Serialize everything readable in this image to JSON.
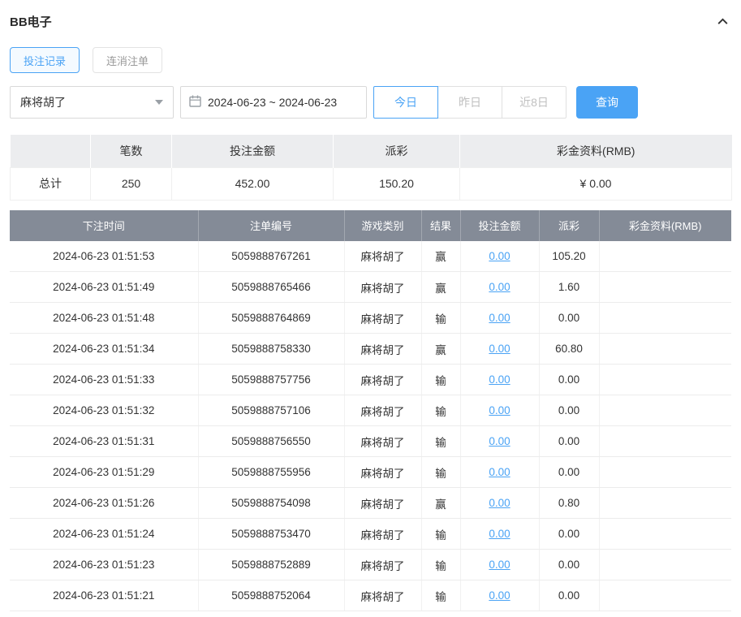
{
  "header": {
    "title": "BB电子"
  },
  "tabs": [
    {
      "label": "投注记录",
      "active": true
    },
    {
      "label": "连消注单",
      "active": false
    }
  ],
  "filters": {
    "game_value": "麻将胡了",
    "date_range": "2024-06-23 ~ 2024-06-23",
    "quick_buttons": [
      {
        "label": "今日",
        "active": true
      },
      {
        "label": "昨日",
        "active": false
      },
      {
        "label": "近8日",
        "active": false
      }
    ],
    "search_label": "查询"
  },
  "summary": {
    "headers": [
      "",
      "笔数",
      "投注金额",
      "派彩",
      "彩金资料(RMB)"
    ],
    "row": {
      "label": "总计",
      "count": "250",
      "bet_amount": "452.00",
      "payout": "150.20",
      "bonus": "¥ 0.00"
    }
  },
  "table": {
    "headers": [
      "下注时间",
      "注单编号",
      "游戏类别",
      "结果",
      "投注金额",
      "派彩",
      "彩金资料(RMB)"
    ],
    "rows": [
      {
        "time": "2024-06-23 01:51:53",
        "order_id": "5059888767261",
        "game": "麻将胡了",
        "result": "赢",
        "bet": "0.00",
        "payout": "105.20",
        "bonus": ""
      },
      {
        "time": "2024-06-23 01:51:49",
        "order_id": "5059888765466",
        "game": "麻将胡了",
        "result": "赢",
        "bet": "0.00",
        "payout": "1.60",
        "bonus": ""
      },
      {
        "time": "2024-06-23 01:51:48",
        "order_id": "5059888764869",
        "game": "麻将胡了",
        "result": "输",
        "bet": "0.00",
        "payout": "0.00",
        "bonus": ""
      },
      {
        "time": "2024-06-23 01:51:34",
        "order_id": "5059888758330",
        "game": "麻将胡了",
        "result": "赢",
        "bet": "0.00",
        "payout": "60.80",
        "bonus": ""
      },
      {
        "time": "2024-06-23 01:51:33",
        "order_id": "5059888757756",
        "game": "麻将胡了",
        "result": "输",
        "bet": "0.00",
        "payout": "0.00",
        "bonus": ""
      },
      {
        "time": "2024-06-23 01:51:32",
        "order_id": "5059888757106",
        "game": "麻将胡了",
        "result": "输",
        "bet": "0.00",
        "payout": "0.00",
        "bonus": ""
      },
      {
        "time": "2024-06-23 01:51:31",
        "order_id": "5059888756550",
        "game": "麻将胡了",
        "result": "输",
        "bet": "0.00",
        "payout": "0.00",
        "bonus": ""
      },
      {
        "time": "2024-06-23 01:51:29",
        "order_id": "5059888755956",
        "game": "麻将胡了",
        "result": "输",
        "bet": "0.00",
        "payout": "0.00",
        "bonus": ""
      },
      {
        "time": "2024-06-23 01:51:26",
        "order_id": "5059888754098",
        "game": "麻将胡了",
        "result": "赢",
        "bet": "0.00",
        "payout": "0.80",
        "bonus": ""
      },
      {
        "time": "2024-06-23 01:51:24",
        "order_id": "5059888753470",
        "game": "麻将胡了",
        "result": "输",
        "bet": "0.00",
        "payout": "0.00",
        "bonus": ""
      },
      {
        "time": "2024-06-23 01:51:23",
        "order_id": "5059888752889",
        "game": "麻将胡了",
        "result": "输",
        "bet": "0.00",
        "payout": "0.00",
        "bonus": ""
      },
      {
        "time": "2024-06-23 01:51:21",
        "order_id": "5059888752064",
        "game": "麻将胡了",
        "result": "输",
        "bet": "0.00",
        "payout": "0.00",
        "bonus": ""
      }
    ]
  },
  "colors": {
    "accent": "#4aa3f5",
    "table_header_bg": "#848b97"
  }
}
